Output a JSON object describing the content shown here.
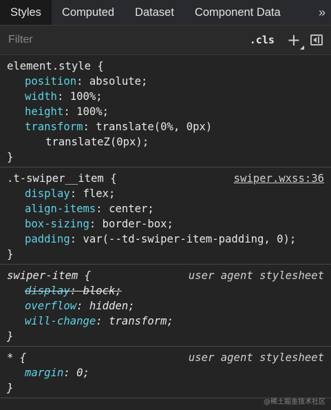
{
  "tabs": [
    {
      "label": "Styles",
      "active": true
    },
    {
      "label": "Computed",
      "active": false
    },
    {
      "label": "Dataset",
      "active": false
    },
    {
      "label": "Component Data",
      "active": false
    }
  ],
  "tabs_more_icon": "»",
  "filter": {
    "placeholder": "Filter",
    "value": ""
  },
  "toolbar": {
    "cls_label": ".cls",
    "add_icon": "+",
    "add_corner": "◢"
  },
  "rules": {
    "element_style": {
      "selector": "element.style {",
      "decls": [
        {
          "prop": "position",
          "value": "absolute;"
        },
        {
          "prop": "width",
          "value": "100%;"
        },
        {
          "prop": "height",
          "value": "100%;"
        },
        {
          "prop": "transform",
          "value": "translate(0%, 0px)"
        }
      ],
      "continuation": "translateZ(0px);",
      "close": "}"
    },
    "swiper_item_class": {
      "selector": ".t-swiper__item {",
      "source": "swiper.wxss:36",
      "decls": [
        {
          "prop": "display",
          "value": "flex;"
        },
        {
          "prop": "align-items",
          "value": "center;"
        },
        {
          "prop": "box-sizing",
          "value": "border-box;"
        },
        {
          "prop": "padding",
          "value": "var(--td-swiper-item-padding, 0);"
        }
      ],
      "close": "}"
    },
    "swiper_item_ua": {
      "selector": "swiper-item {",
      "source": "user agent stylesheet",
      "decls": [
        {
          "prop": "display",
          "value": "block;"
        },
        {
          "prop": "overflow",
          "value": "hidden;"
        },
        {
          "prop": "will-change",
          "value": "transform;"
        }
      ],
      "close": "}"
    },
    "universal_ua": {
      "selector": "* {",
      "source": "user agent stylesheet",
      "decls": [
        {
          "prop": "margin",
          "value": "0;"
        }
      ],
      "close": "}"
    }
  },
  "colors": {
    "property": "#5fd3e6",
    "background": "#242424",
    "tabbar": "#292a2d",
    "active_tab": "#1a1a1a"
  },
  "watermark": "@稀土掘金技术社区"
}
